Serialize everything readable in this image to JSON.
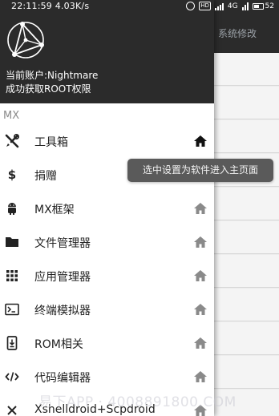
{
  "status_bar": {
    "time": "22:11:59",
    "speed": "4.03K/s",
    "network": "4G",
    "battery": "52"
  },
  "background_app": {
    "title": "系统修改"
  },
  "drawer": {
    "account_line": "当前账户:Nightmare",
    "root_line": "成功获取ROOT权限",
    "section": "MX",
    "items": [
      {
        "label": "工具箱",
        "icon": "tools-icon",
        "home_selected": true
      },
      {
        "label": "捐赠",
        "icon": "dollar-icon",
        "home_selected": false
      },
      {
        "label": "MX框架",
        "icon": "android-icon",
        "home_selected": false
      },
      {
        "label": "文件管理器",
        "icon": "folder-icon",
        "home_selected": false
      },
      {
        "label": "应用管理器",
        "icon": "apps-grid-icon",
        "home_selected": false
      },
      {
        "label": "终端模拟器",
        "icon": "terminal-icon",
        "home_selected": false
      },
      {
        "label": "ROM相关",
        "icon": "phone-download-icon",
        "home_selected": false
      },
      {
        "label": "代码编辑器",
        "icon": "code-icon",
        "home_selected": false
      },
      {
        "label": "Xshelldroid+Scpdroid",
        "icon": "close-x-icon",
        "home_selected": false
      }
    ]
  },
  "toast": {
    "text": "选中设置为软件进入主页面"
  },
  "watermark": {
    "text": "易下APP · 4008891800.COM"
  },
  "colors": {
    "header_bg": "#2b2b2b",
    "home_active": "#111111",
    "home_inactive": "#8a8a8a",
    "toast_bg": "#5a5a5a"
  }
}
